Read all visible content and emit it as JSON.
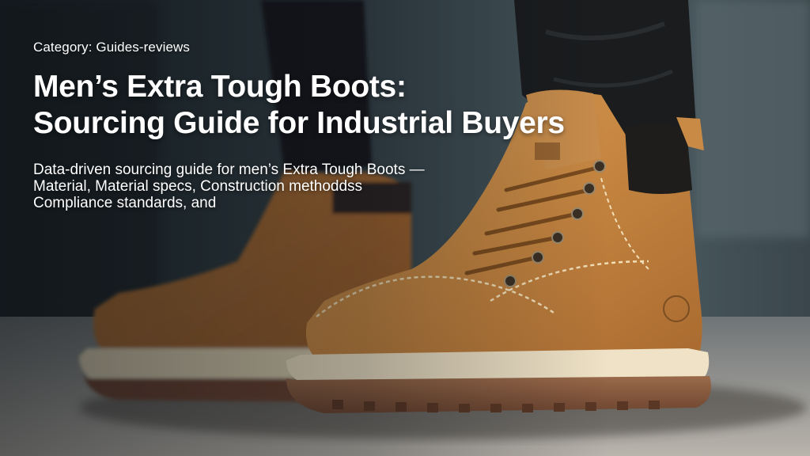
{
  "category": "Category: Guides-reviews",
  "title": {
    "line1": "Men’s Extra Tough Boots:",
    "line2": "Sourcing Guide for Industrial Buyers"
  },
  "description": {
    "line1": "Data-driven sourcing guide for men’s Extra Tough Boots —",
    "line2": "Material, Material specs, Construction methoddss",
    "line3": "Compliance standards, and"
  },
  "colors": {
    "boot_leather": "#c88a45",
    "sole": "#8a5b3d",
    "midsole": "#efe2c6",
    "background": "#2a3338"
  }
}
